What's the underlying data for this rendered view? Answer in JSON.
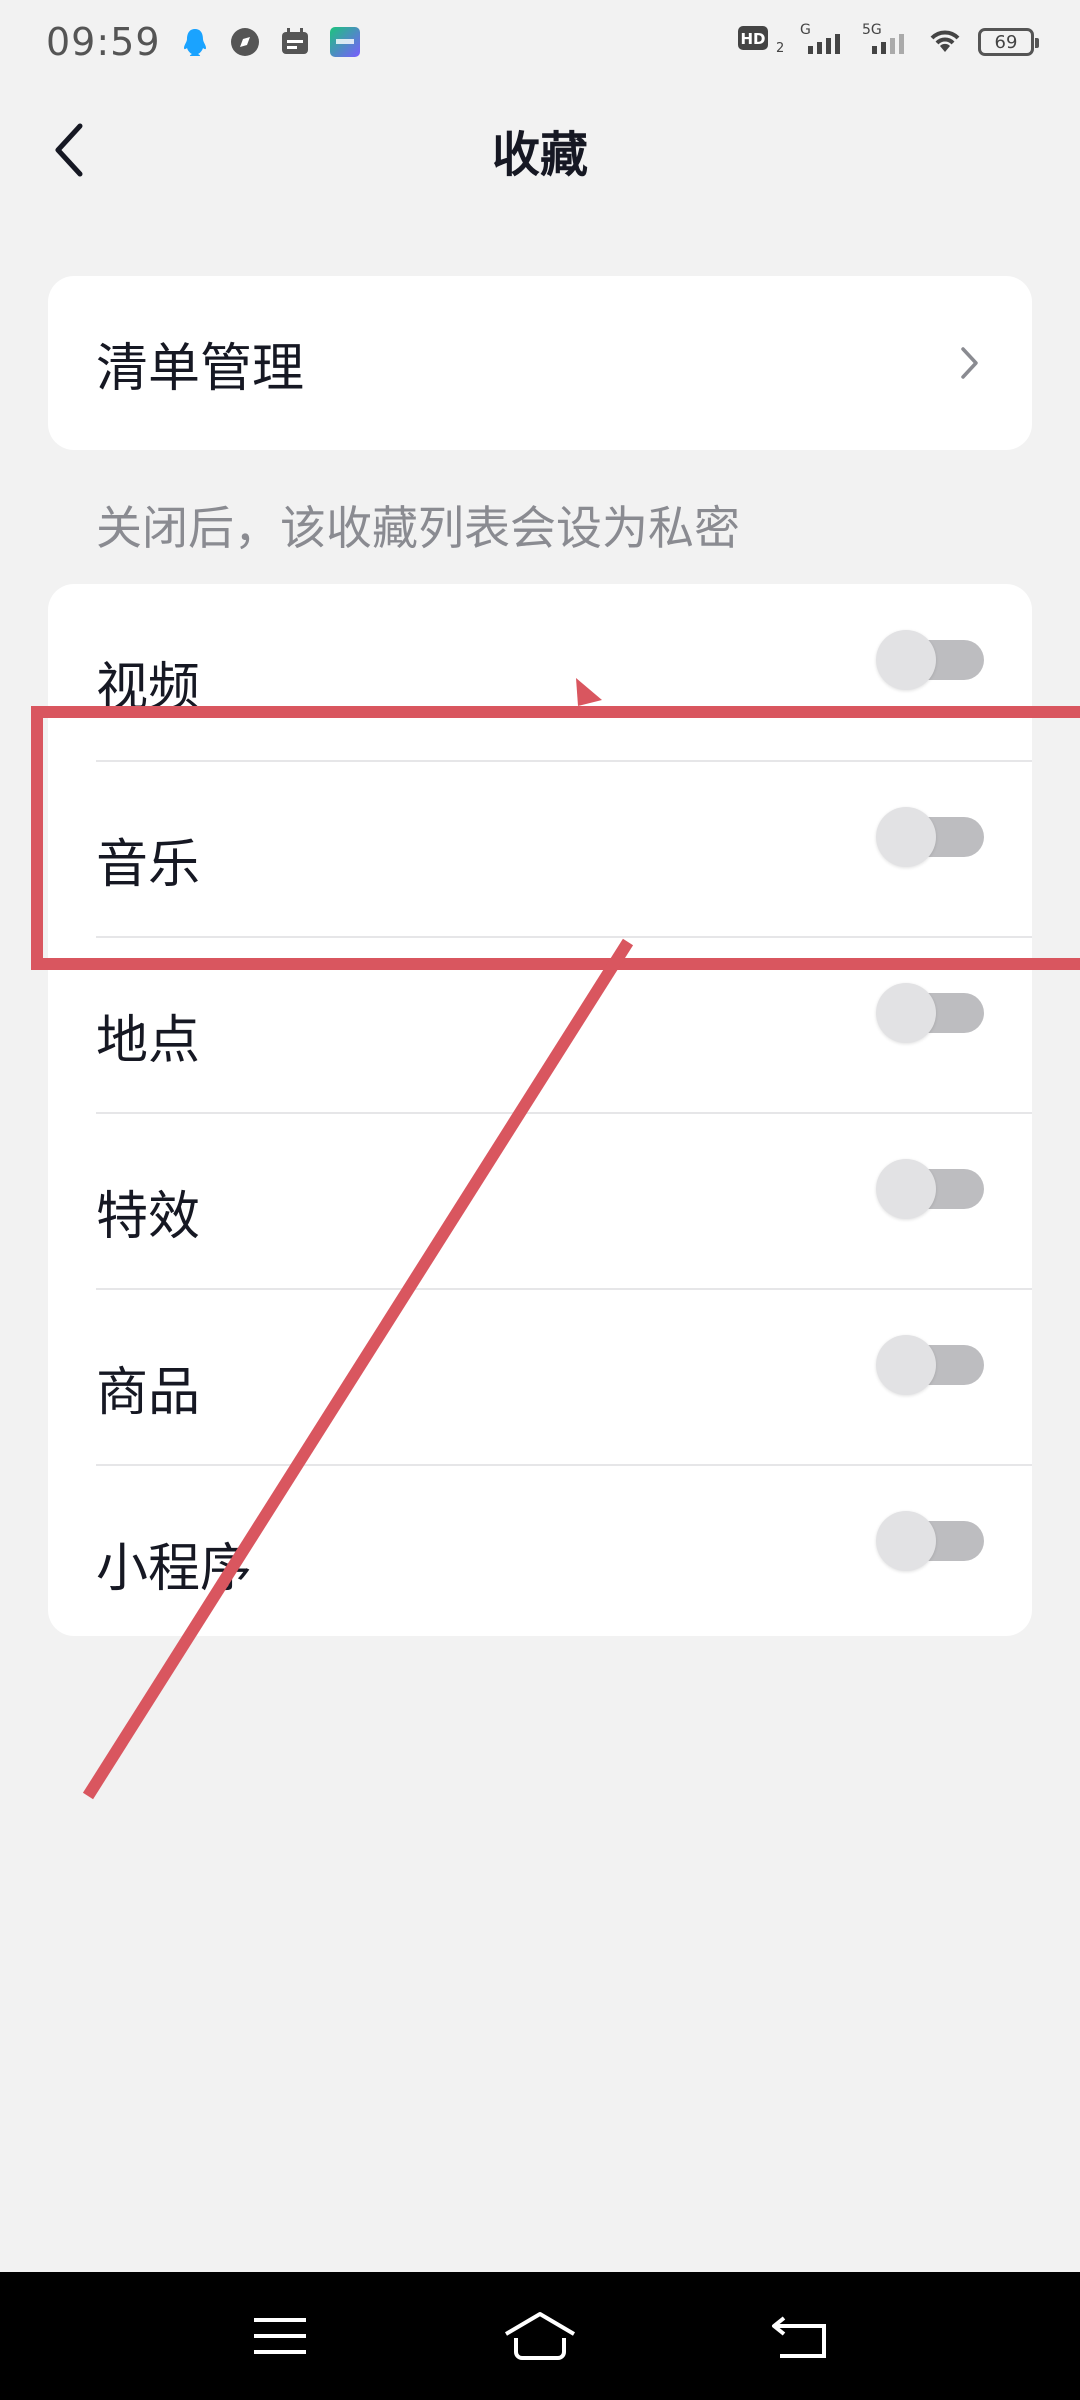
{
  "status_bar": {
    "time": "09:59",
    "battery": "69",
    "network_labels": [
      "HD₂",
      "G",
      "5G"
    ],
    "icons": [
      "qq-icon",
      "compass-icon",
      "calendar-icon",
      "iqiyi-icon",
      "hd-icon",
      "signal-icon",
      "signal-5g-icon",
      "wifi-icon",
      "battery-icon"
    ]
  },
  "header": {
    "title": "收藏",
    "back_icon": "back-arrow-icon"
  },
  "manage": {
    "label": "清单管理",
    "icon": "chevron-right-icon"
  },
  "hint": "关闭后，该收藏列表会设为私密",
  "toggles": [
    {
      "label": "视频",
      "on": false
    },
    {
      "label": "音乐",
      "on": false
    },
    {
      "label": "地点",
      "on": false
    },
    {
      "label": "特效",
      "on": false
    },
    {
      "label": "商品",
      "on": false
    },
    {
      "label": "小程序",
      "on": false
    }
  ],
  "nav": {
    "icons": [
      "menu-icon",
      "home-icon",
      "back-icon"
    ]
  },
  "colors": {
    "background": "#f2f2f2",
    "card": "#ffffff",
    "annotation": "#d9565f",
    "toggle_track": "#bdbdc0",
    "toggle_knob": "#e2e2e4"
  }
}
